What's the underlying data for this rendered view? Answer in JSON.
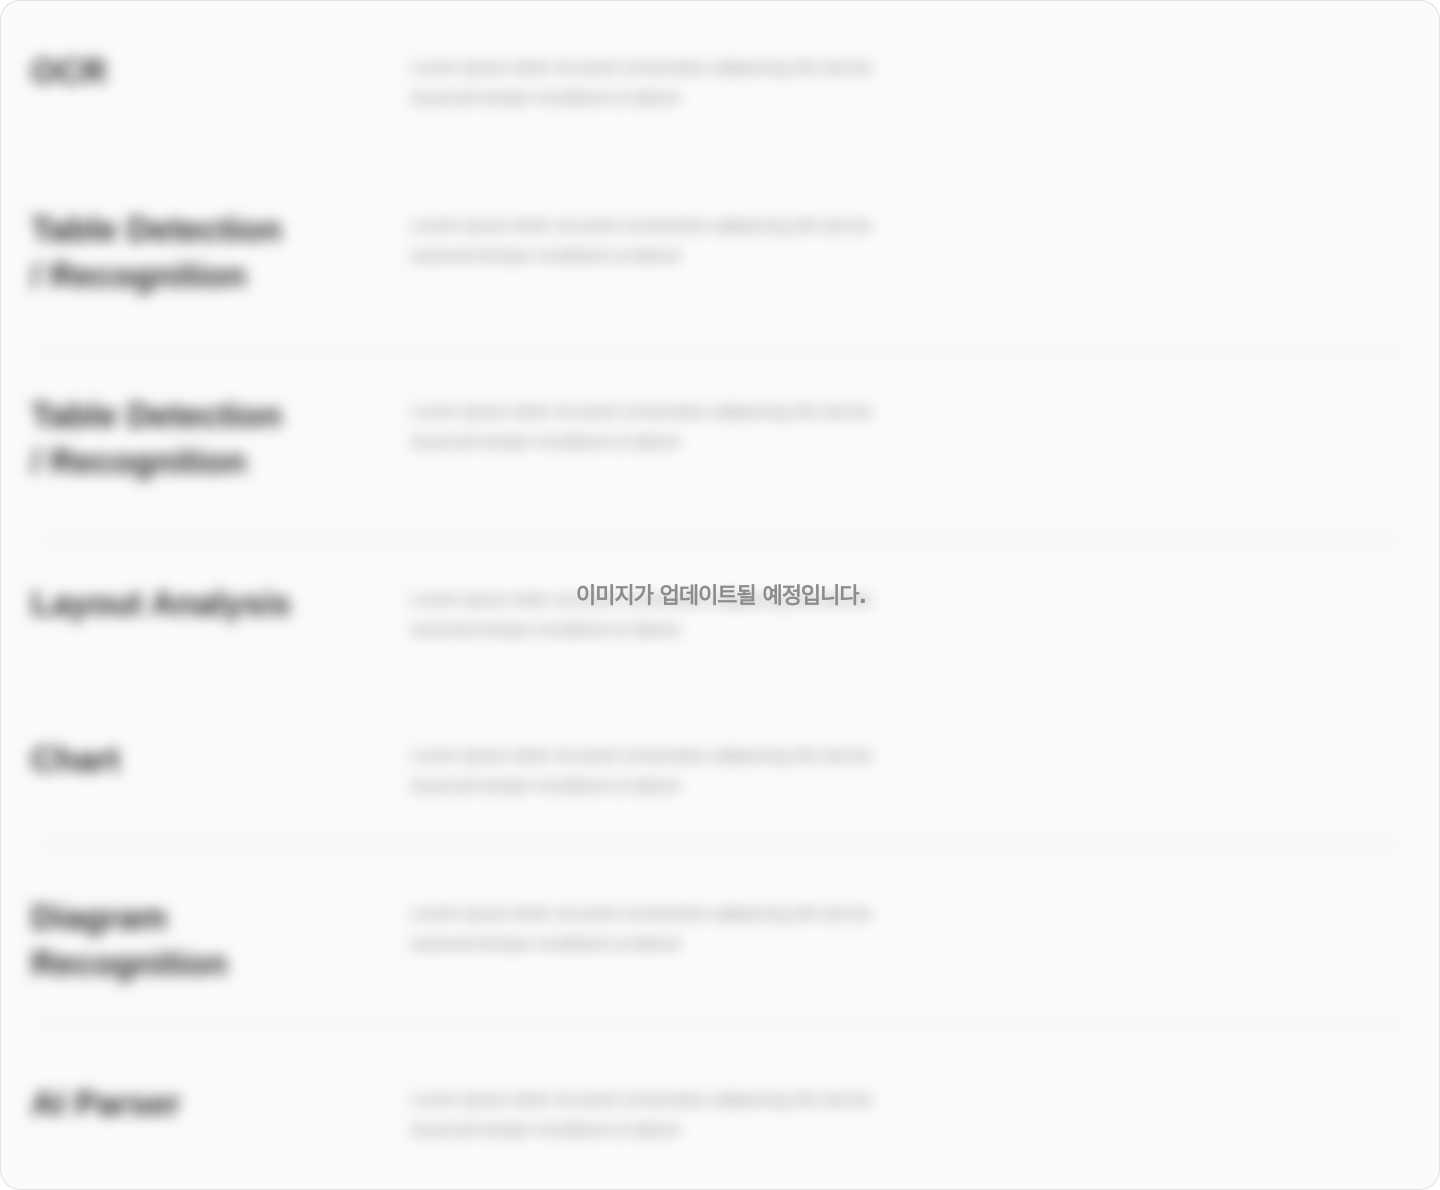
{
  "overlay": {
    "message": "이미지가 업데이트될 예정입니다."
  },
  "rows": [
    {
      "title": "OCR",
      "description": "Lorem ipsum dolor sit amet consectetur adipiscing elit sed do eiusmod tempor incididunt ut labore"
    },
    {
      "title": "Table Detection / Recognition",
      "description": "Lorem ipsum dolor sit amet consectetur adipiscing elit sed do eiusmod tempor incididunt ut labore"
    },
    {
      "title": "Table Detection / Recognition",
      "description": "Lorem ipsum dolor sit amet consectetur adipiscing elit sed do eiusmod tempor incididunt ut labore"
    },
    {
      "title": "Layout Analysis",
      "description": "Lorem ipsum dolor sit amet consectetur adipiscing elit sed do eiusmod tempor incididunt ut labore"
    },
    {
      "title": "Chart",
      "description": "Lorem ipsum dolor sit amet consectetur adipiscing elit sed do eiusmod tempor incididunt ut labore"
    },
    {
      "title": "Diagram Recognition",
      "description": "Lorem ipsum dolor sit amet consectetur adipiscing elit sed do eiusmod tempor incididunt ut labore"
    },
    {
      "title": "AI Parser",
      "description": "Lorem ipsum dolor sit amet consectetur adipiscing elit sed do eiusmod tempor incididunt ut labore"
    }
  ]
}
